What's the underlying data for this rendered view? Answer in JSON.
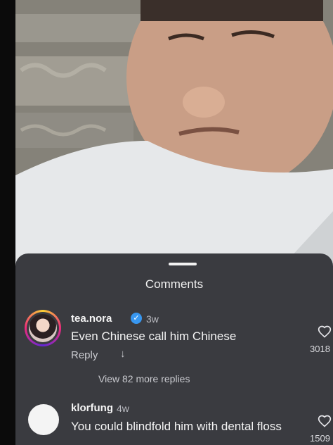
{
  "video": {
    "description_icon": "video-frame"
  },
  "sheet": {
    "title": "Comments"
  },
  "comments": [
    {
      "username": "tea.nora",
      "time": "3w",
      "text": "Even Chinese call him Chinese",
      "reply_label": "Reply",
      "view_more": "View 82 more replies",
      "likes": "3018",
      "verified": true
    },
    {
      "username": "klorfung",
      "time": "4w",
      "text": "You could blindfold him with dental floss",
      "likes": "1509"
    }
  ],
  "colors": {
    "sheet_bg": "#3a3b40",
    "verified": "#3897f0"
  }
}
